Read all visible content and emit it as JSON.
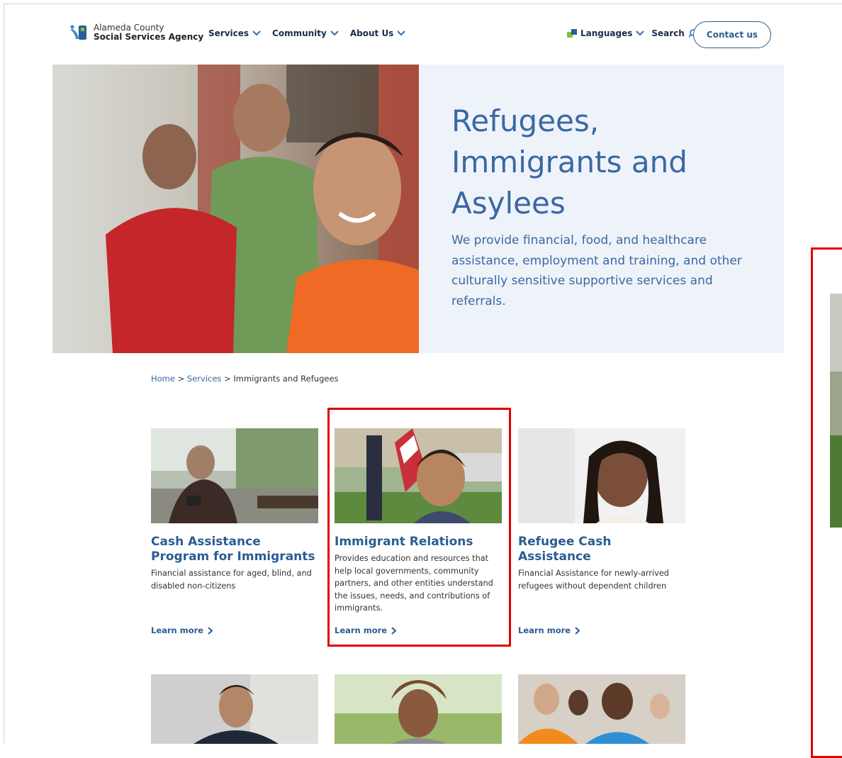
{
  "header": {
    "logo_line1": "Alameda County",
    "logo_line2": "Social Services Agency",
    "nav": [
      {
        "label": "Services"
      },
      {
        "label": "Community"
      },
      {
        "label": "About Us"
      }
    ],
    "languages_label": "Languages",
    "search_label": "Search",
    "contact_label": "Contact us"
  },
  "hero": {
    "title": "Refugees, Immigrants and Asylees",
    "description": "We provide financial, food, and healthcare assistance, employment and training, and other culturally sensitive supportive services and referrals."
  },
  "breadcrumb": {
    "home": "Home",
    "sep1": " > ",
    "services": "Services",
    "sep2": " > ",
    "current": "Immigrants and Refugees"
  },
  "cards": [
    {
      "title": "Cash Assistance Program for Immigrants",
      "description": "Financial assistance for aged, blind, and disabled non-citizens",
      "link": "Learn more"
    },
    {
      "title": "Immigrant Relations",
      "description": "Provides education and resources that help local governments, community partners, and other entities understand the issues, needs, and contributions of immigrants.",
      "link": "Learn more"
    },
    {
      "title": "Refugee Cash Assistance",
      "description": "Financial Assistance for newly-arrived refugees without dependent children",
      "link": "Learn more"
    }
  ],
  "colors": {
    "brand_blue": "#2a5d91",
    "hero_text": "#3a68a3",
    "hero_bg": "#eef3fa",
    "highlight": "#e00000"
  }
}
